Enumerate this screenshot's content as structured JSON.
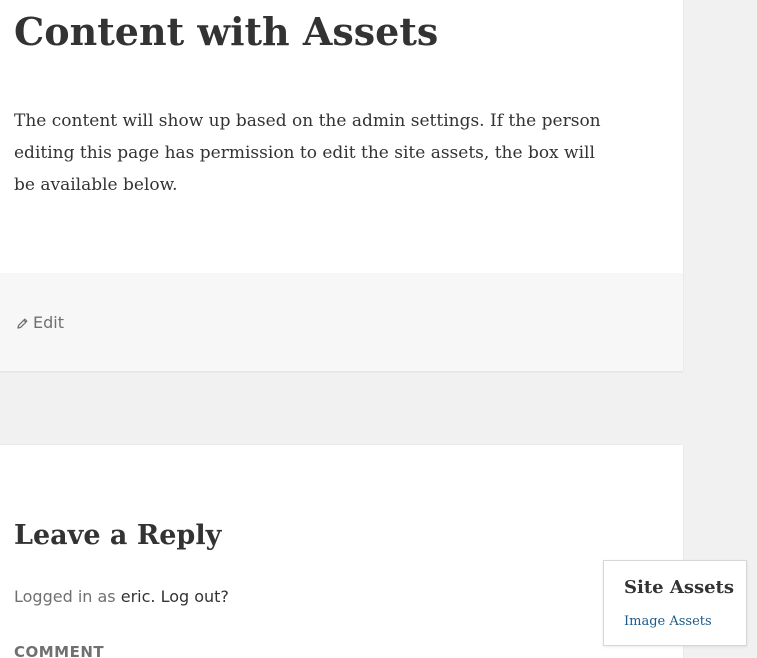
{
  "article": {
    "title": "Content with Assets",
    "content": "The content will show up based on the admin settings. If the person editing this page has permission to edit the site assets, the box will be available below.",
    "edit_label": "Edit",
    "edit_icon": "pencil-icon"
  },
  "comments": {
    "reply_title": "Leave a Reply",
    "logged_in_prefix": "Logged in as ",
    "username": "eric",
    "separator": ". ",
    "logout_label": "Log out?",
    "comment_label": "COMMENT"
  },
  "site_assets": {
    "title": "Site Assets",
    "link_label": "Image Assets",
    "link_color": "#1a5a8a"
  },
  "colors": {
    "page_background": "#f1f1f1",
    "card_background": "#ffffff",
    "footer_background": "#f7f7f7",
    "text": "#333333",
    "muted_text": "#707070"
  }
}
